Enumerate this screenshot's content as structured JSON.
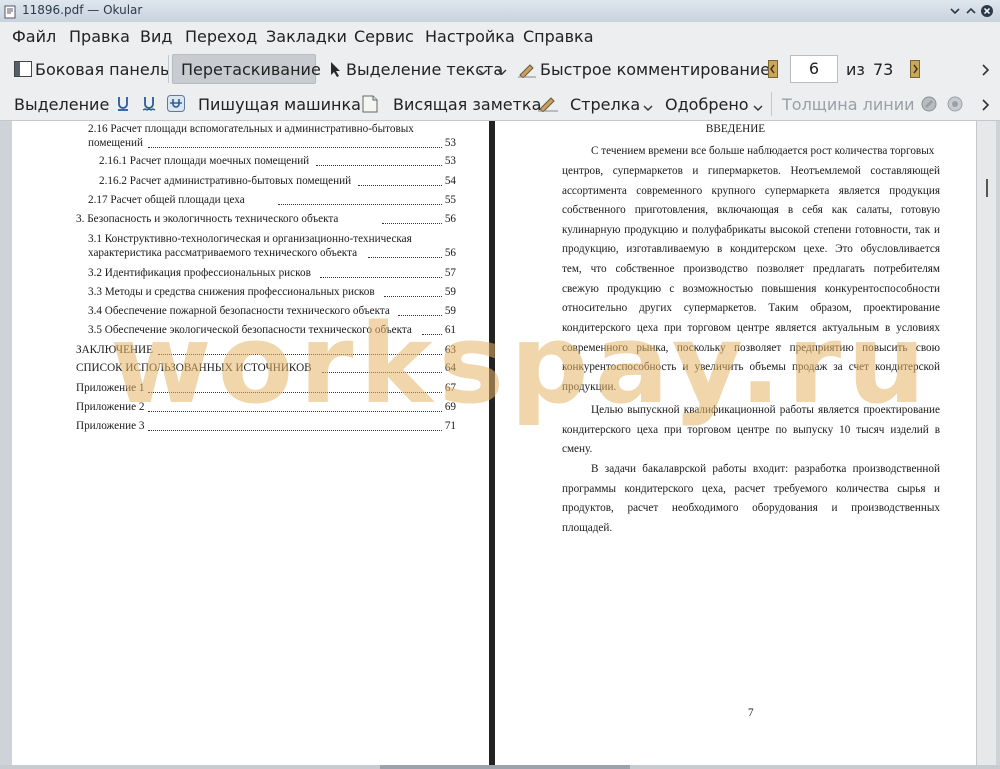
{
  "window": {
    "title": "11896.pdf  — Okular"
  },
  "menu": [
    "Файл",
    "Правка",
    "Вид",
    "Переход",
    "Закладки",
    "Сервис",
    "Настройка",
    "Справка"
  ],
  "toolbar1": {
    "sidebar": "Боковая панель",
    "drag": "Перетаскивание",
    "text_select": "Выделение текста",
    "quick_comment": "Быстрое комментирование",
    "page_current": "6",
    "page_of": "из",
    "page_total": "73"
  },
  "toolbar2": {
    "selection": "Выделение",
    "typewriter": "Пишущая машинка",
    "sticky_note": "Висящая заметка",
    "arrow": "Стрелка",
    "approved": "Одобрено",
    "line_width": "Толщина линии"
  },
  "toc": [
    {
      "text": "2.16 Расчет площади вспомогательных и административно-бытовых",
      "page": ""
    },
    {
      "text": "помещений",
      "page": "53"
    },
    {
      "text": "2.16.1 Расчет площади моечных помещений",
      "page": "53"
    },
    {
      "text": "2.16.2 Расчет административно-бытовых помещений",
      "page": "54"
    },
    {
      "text": "2.17 Расчет общей площади цеха",
      "page": "55"
    },
    {
      "text": "3.   Безопасность и экологичность технического объекта",
      "page": "56"
    },
    {
      "text": "3.1 Конструктивно-технологическая и организационно-техническая",
      "page": ""
    },
    {
      "text": "характеристика рассматриваемого технического объекта",
      "page": "56"
    },
    {
      "text": "3.2 Идентификация профессиональных рисков",
      "page": "57"
    },
    {
      "text": "3.3 Методы и средства снижения профессиональных рисков",
      "page": "59"
    },
    {
      "text": "3.4 Обеспечение пожарной безопасности технического объекта",
      "page": "59"
    },
    {
      "text": "3.5 Обеспечение экологической безопасности технического объекта",
      "page": "61"
    },
    {
      "text": "ЗАКЛЮЧЕНИЕ",
      "page": "63"
    },
    {
      "text": "СПИСОК ИСПОЛЬЗОВАННЫХ ИСТОЧНИКОВ",
      "page": "64"
    },
    {
      "text": "Приложение 1",
      "page": "67"
    },
    {
      "text": "Приложение 2",
      "page": "69"
    },
    {
      "text": "Приложение 3",
      "page": "71"
    }
  ],
  "intro": {
    "heading": "ВВЕДЕНИЕ",
    "lines": [
      "С течением времени все больше наблюдается рост количества торговых",
      "центров, супермаркетов и гипермаркетов. Неотъемлемой составляющей",
      "ассортимента современного крупного супермаркета является продукция",
      "собственного приготовления, включающая в себя как салаты, готовую",
      "кулинарную продукцию и полуфабрикаты высокой степени готовности, так и",
      "продукцию, изготавливаемую в кондитерском цехе. Это обусловливается",
      "тем, что собственное производство позволяет предлагать потребителям",
      "свежую продукцию с возможностью повышения конкурентоспособности",
      "относительно других супермаркетов. Таким образом, проектирование",
      "кондитерского цеха при торговом центре является актуальным в условиях",
      "современного рынка, поскольку позволяет предприятию повысить свою",
      "конкурентоспособность и увеличить объемы продаж за счет кондитерской",
      "продукции.",
      "Целью выпускной квалификационной работы является проектирование",
      "кондитерского цеха при торговом центре по выпуску 10 тысяч изделий в",
      "смену.",
      "В задачи бакалаврской работы входит: разработка производственной",
      "программы кондитерского цеха, расчет требуемого количества сырья и",
      "продуктов, расчет необходимого оборудования и производственных",
      "площадей."
    ],
    "page_number": "7"
  },
  "watermark": "workspay.ru",
  "colors": {
    "watermark": "#e4b464",
    "pressed": "#c8ccd1",
    "chrome": "#eceef0"
  }
}
